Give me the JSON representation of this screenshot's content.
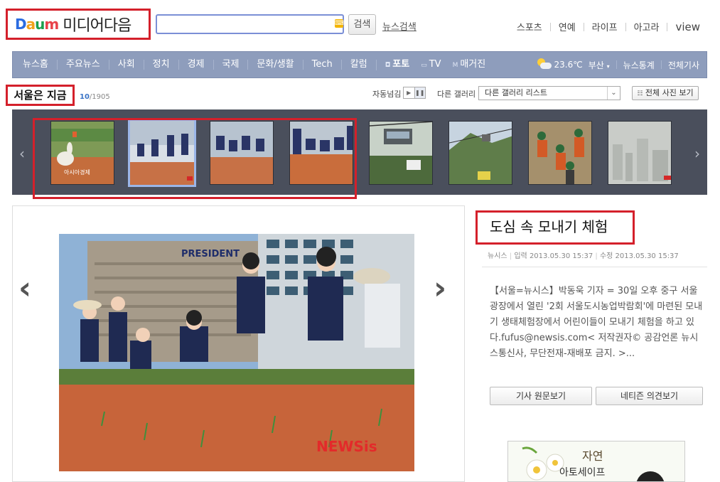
{
  "header": {
    "logo_text": "DAUM",
    "logo_sub": "미디어다음",
    "search_placeholder": "",
    "search_button": "검색",
    "news_search_link": "뉴스검색",
    "top_links": [
      "스포츠",
      "연예",
      "라이프",
      "아고라",
      "view"
    ]
  },
  "nav": {
    "items": [
      "뉴스홈",
      "주요뉴스",
      "사회",
      "정치",
      "경제",
      "국제",
      "문화/생활",
      "Tech",
      "칼럼"
    ],
    "media_items": [
      {
        "label": "포토",
        "selected": true,
        "icon": "camera-icon"
      },
      {
        "label": "TV",
        "selected": false,
        "icon": "tv-icon"
      },
      {
        "label": "매거진",
        "selected": false,
        "icon": "magazine-icon"
      }
    ],
    "weather_temp": "23.6℃",
    "weather_city": "부산",
    "news_stats": "뉴스통계",
    "all_articles": "전체기사"
  },
  "gallery": {
    "title": "서울은 지금",
    "current": "10",
    "total": "/1905",
    "autoplay_label": "자동넘김",
    "other_gallery_label": "다른 갤러리",
    "other_gallery_select": "다른 갤러리 리스트",
    "all_photos_button": "전체 사진 보기",
    "thumbnails": [
      {
        "caption": "goose in rice paddy",
        "selected": false
      },
      {
        "caption": "students planting rice",
        "selected": true
      },
      {
        "caption": "students planting rice row",
        "selected": false
      },
      {
        "caption": "students bending in paddy",
        "selected": false
      },
      {
        "caption": "cable car",
        "selected": false
      },
      {
        "caption": "cable car over city",
        "selected": false
      },
      {
        "caption": "rescue workers",
        "selected": false
      },
      {
        "caption": "hazy city skyline",
        "selected": false
      }
    ]
  },
  "article": {
    "title": "도심 속 모내기 체험",
    "source": "뉴시스",
    "posted": "입력 2013.05.30 15:37",
    "modified": "수정 2013.05.30 15:37",
    "body": "【서울=뉴시스】박동욱 기자 = 30일 오후 중구 서울광장에서 열린 '2회 서울도시농업박람회'에 마련된 모내기 생태체험장에서 어린이들이 모내기 체험을 하고 있다.fufus@newsis.com< 저작권자© 공감언론 뉴시스통신사, 무단전재-재배포 금지. >...",
    "button_original": "기사 원문보기",
    "button_comments": "네티즌 의견보기",
    "photo_watermark": "NEWSis",
    "building_sign": "PRESIDENT",
    "ad_text_1": "자연",
    "ad_text_2": "아토세이프"
  },
  "colors": {
    "nav_bg": "#8e9dbc",
    "strip_bg": "#4a4f5c",
    "highlight_red": "#d4202b",
    "accent_blue": "#3b74c6"
  }
}
